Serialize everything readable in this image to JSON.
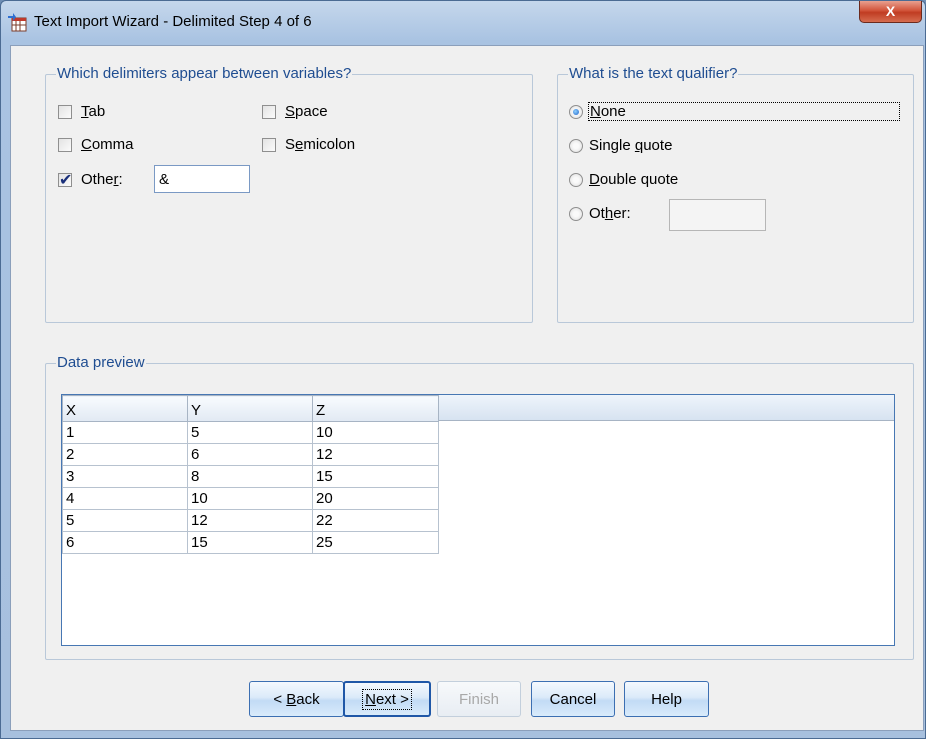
{
  "window": {
    "title": "Text Import Wizard - Delimited Step 4 of 6",
    "close_label": "X"
  },
  "delimiters": {
    "legend": "Which delimiters appear between variables?",
    "tab": {
      "label_mnemonic": "T",
      "label_rest": "ab",
      "checked": false
    },
    "space": {
      "label_mnemonic": "S",
      "label_rest": "pace",
      "checked": false
    },
    "comma": {
      "label_mnemonic": "C",
      "label_rest": "omma",
      "checked": false
    },
    "semicolon": {
      "label_pre": "S",
      "label_mnemonic": "e",
      "label_rest": "micolon",
      "checked": false
    },
    "other": {
      "label_pre": "Othe",
      "label_mnemonic": "r",
      "label_rest": ":",
      "checked": true,
      "value": "&"
    }
  },
  "qualifier": {
    "legend": "What is the text qualifier?",
    "none": {
      "label_mnemonic": "N",
      "label_rest": "one",
      "selected": true
    },
    "single": {
      "label_pre": "Single ",
      "label_mnemonic": "q",
      "label_rest": "uote",
      "selected": false
    },
    "double": {
      "label_mnemonic": "D",
      "label_rest": "ouble quote",
      "selected": false
    },
    "other": {
      "label_pre": "Ot",
      "label_mnemonic": "h",
      "label_rest": "er:",
      "selected": false,
      "value": ""
    }
  },
  "preview": {
    "legend": "Data preview",
    "columns": [
      "X",
      "Y",
      "Z"
    ],
    "rows": [
      [
        "1",
        "5",
        "10"
      ],
      [
        "2",
        "6",
        "12"
      ],
      [
        "3",
        "8",
        "15"
      ],
      [
        "4",
        "10",
        "20"
      ],
      [
        "5",
        "12",
        "22"
      ],
      [
        "6",
        "15",
        "25"
      ]
    ]
  },
  "buttons": {
    "back": {
      "pre": "< ",
      "mnemonic": "B",
      "rest": "ack"
    },
    "next": {
      "mnemonic": "N",
      "rest": "ext >"
    },
    "finish": "Finish",
    "cancel": "Cancel",
    "help": "Help"
  }
}
